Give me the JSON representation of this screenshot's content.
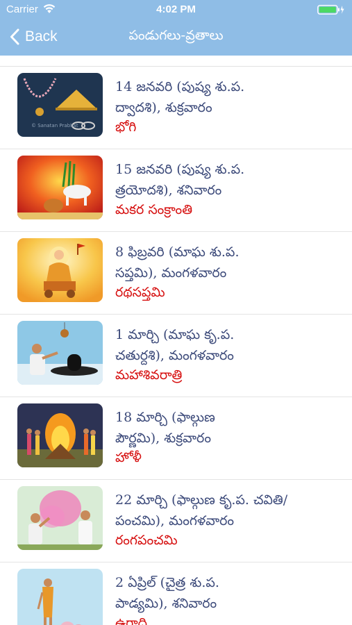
{
  "status_bar": {
    "carrier": "Carrier",
    "time": "4:02 PM"
  },
  "navbar": {
    "back_label": "Back",
    "title": "పండుగలు-వ్రతాలు"
  },
  "colors": {
    "header": "#8fbde6",
    "date_text": "#3c4a7a",
    "festival_name": "#d60f0f"
  },
  "festivals": [
    {
      "date_line1": "14 జనవరి (పుష్య శు.ప.",
      "date_line2": "ద్వాదశి), శుక్రవారం",
      "name": "భోగి",
      "thumb_icon": "bhogi-image",
      "thumb_watermark": "© Sanatan Prabhat"
    },
    {
      "date_line1": "15 జనవరి (పుష్య శు.ప.",
      "date_line2": "త్రయోదశి), శనివారం",
      "name": "మకర సంక్రాంతి",
      "thumb_icon": "sankranti-image"
    },
    {
      "date_line1": "8 ఫిబ్రవరి (మాఘ శు.ప.",
      "date_line2": "సప్తమి), మంగళవారం",
      "name": "రథసప్తమి",
      "thumb_icon": "rathasaptami-image"
    },
    {
      "date_line1": "1 మార్చి (మాఘ కృ.ప.",
      "date_line2": "చతుర్దశి), మంగళవారం",
      "name": "మహాశివరాత్రి",
      "thumb_icon": "mahashivaratri-image"
    },
    {
      "date_line1": "18 మార్చి (ఫాల్గుణ",
      "date_line2": "పౌర్ణమి), శుక్రవారం",
      "name": "హోళీ",
      "thumb_icon": "holi-image"
    },
    {
      "date_line1": "22 మార్చి (ఫాల్గుణ కృ.ప. చవితి/",
      "date_line2": "పంచమి), మంగళవారం",
      "name": "రంగపంచమి",
      "thumb_icon": "rangapanchami-image"
    },
    {
      "date_line1": "2 ఏప్రిల్ (చైత్ర శు.ప.",
      "date_line2": "పాడ్యమి), శనివారం",
      "name": "ఉగాది",
      "thumb_icon": "ugadi-image"
    }
  ]
}
